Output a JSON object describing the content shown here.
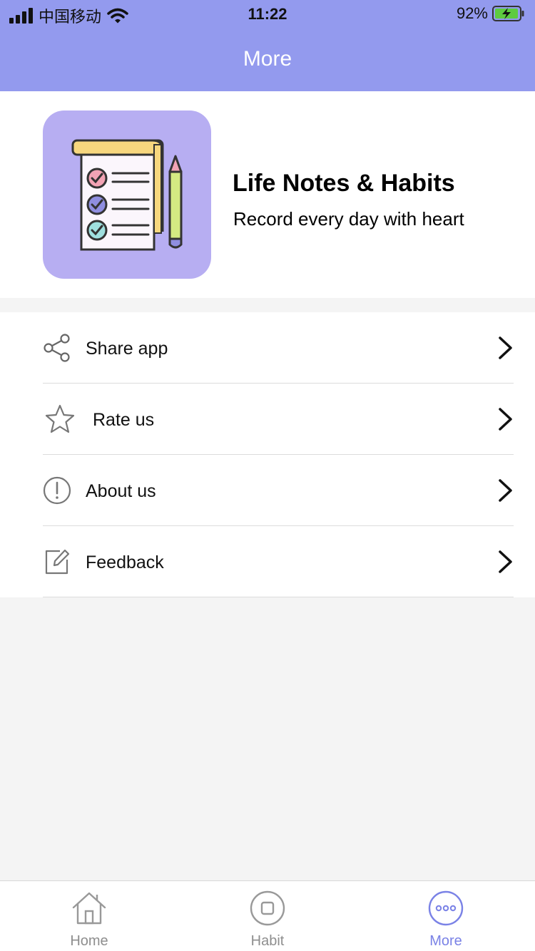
{
  "status_bar": {
    "carrier": "中国移动",
    "time": "11:22",
    "battery": "92%"
  },
  "nav": {
    "title": "More"
  },
  "profile": {
    "app_name": "Life Notes & Habits",
    "slogan": "Record every day with heart"
  },
  "menu": [
    {
      "label": "Share app",
      "icon": "share-icon"
    },
    {
      "label": "Rate us",
      "icon": "star-icon"
    },
    {
      "label": "About us",
      "icon": "info-icon"
    },
    {
      "label": "Feedback",
      "icon": "edit-icon"
    }
  ],
  "tabbar": [
    {
      "label": "Home",
      "icon": "home-icon",
      "active": false
    },
    {
      "label": "Habit",
      "icon": "habit-icon",
      "active": false
    },
    {
      "label": "More",
      "icon": "more-icon",
      "active": true
    }
  ],
  "colors": {
    "accent": "#939aee",
    "logo_bg": "#b7aef2",
    "active_tab": "#7a82e6"
  }
}
